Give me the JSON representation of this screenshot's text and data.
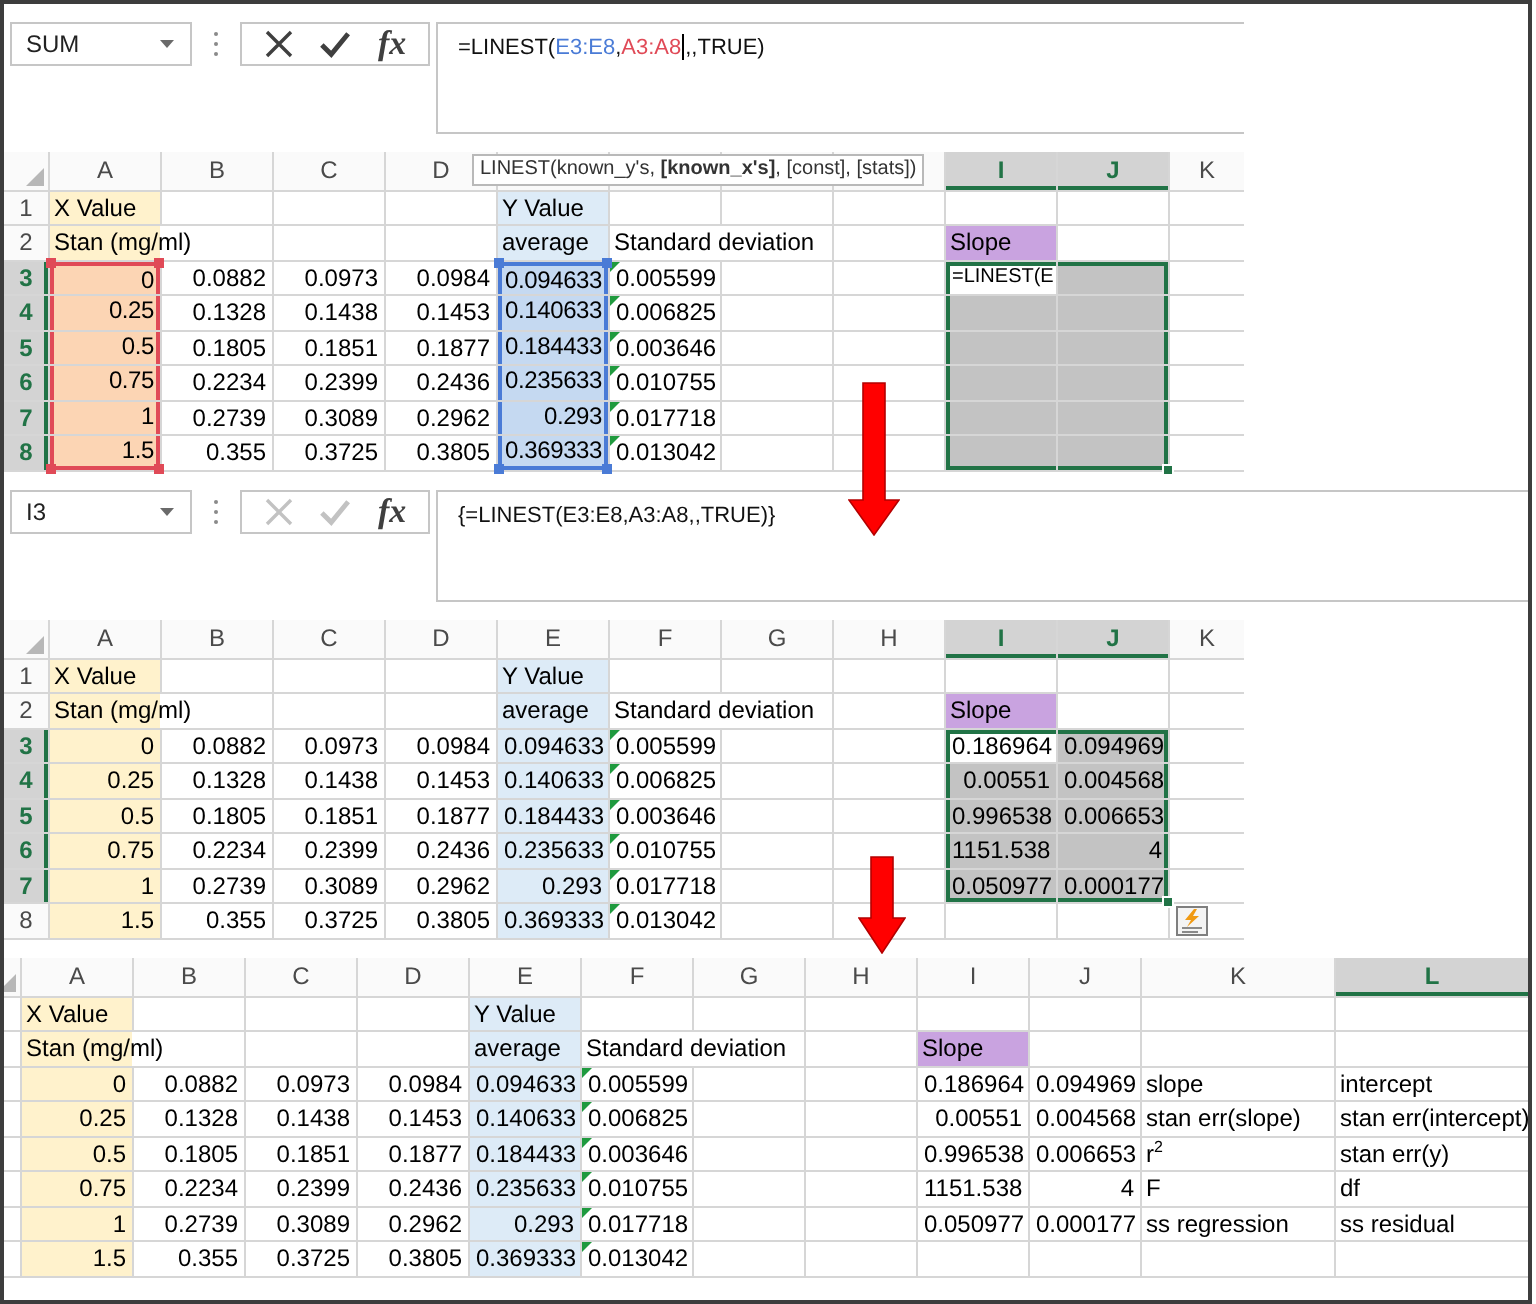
{
  "panels": [
    {
      "formula_bar": {
        "name_box": "SUM",
        "buttons": [
          {
            "kind": "cancel",
            "disabled": false
          },
          {
            "kind": "enter",
            "disabled": false
          },
          {
            "kind": "function",
            "label": "fx",
            "disabled": false
          }
        ],
        "formula": [
          {
            "kind": "plain",
            "text": "=LINEST("
          },
          {
            "kind": "ref",
            "text": "E3:E8",
            "color": "#4a7bd6"
          },
          {
            "kind": "plain",
            "text": ","
          },
          {
            "kind": "ref",
            "text": "A3:A8",
            "color": "#e04a57"
          },
          {
            "kind": "caret"
          },
          {
            "kind": "plain",
            "text": ",,TRUE)"
          }
        ]
      },
      "tooltip": "LINEST(known_y's, **[known_x's]**, [const], [stats])",
      "quick_analysis": false,
      "columns": [
        {
          "label": "A",
          "selected": false
        },
        {
          "label": "B",
          "selected": false
        },
        {
          "label": "C",
          "selected": false
        },
        {
          "label": "D",
          "selected": false
        },
        {},
        {},
        {},
        {},
        {
          "label": "I",
          "selected": true
        },
        {
          "label": "J",
          "selected": true
        },
        {
          "label": "K",
          "selected": false
        }
      ],
      "rows": [
        {
          "number": "1",
          "selected": false,
          "cells": [
            {
              "kind": "text",
              "text": "X Value",
              "color": "#fff2cc"
            },
            null,
            null,
            null,
            {
              "kind": "text",
              "text": "Y Value",
              "color": "#ddebf7"
            }
          ]
        },
        {
          "number": "2",
          "selected": false,
          "cells": [
            {
              "kind": "text",
              "text": "Stan (mg/ml)",
              "color": "#fff2cc"
            },
            null,
            null,
            null,
            {
              "kind": "text",
              "text": "average",
              "color": "#ddebf7"
            },
            {
              "kind": "text",
              "text": "Standard deviation"
            },
            null,
            null,
            {
              "kind": "text",
              "text": "Slope",
              "color": "#c9a3e0"
            }
          ]
        },
        {
          "number": "3",
          "selected": true,
          "cells": [
            {
              "kind": "num",
              "text": "0",
              "color": "#fcd5b4",
              "reference": {
                "color": "#e04a57"
              }
            },
            {
              "kind": "num",
              "text": "0.0882"
            },
            {
              "kind": "num",
              "text": "0.0973"
            },
            {
              "kind": "num",
              "text": "0.0984"
            },
            {
              "kind": "num",
              "text": "0.094633",
              "color": "#c5d9f1",
              "reference": {
                "color": "#4a7bd6"
              }
            },
            {
              "kind": "flag",
              "text": "0.005599"
            },
            null,
            null,
            {
              "kind": "edit",
              "text": "=LINEST(E"
            }
          ]
        },
        {
          "number": "4",
          "selected": true,
          "cells": [
            {
              "kind": "num",
              "text": "0.25",
              "color": "#fcd5b4",
              "reference": {
                "color": "#e04a57"
              }
            },
            {
              "kind": "num",
              "text": "0.1328"
            },
            {
              "kind": "num",
              "text": "0.1438"
            },
            {
              "kind": "num",
              "text": "0.1453"
            },
            {
              "kind": "num",
              "text": "0.140633",
              "color": "#c5d9f1",
              "reference": {
                "color": "#4a7bd6"
              }
            },
            {
              "kind": "flag",
              "text": "0.006825"
            }
          ]
        },
        {
          "number": "5",
          "selected": true,
          "cells": [
            {
              "kind": "num",
              "text": "0.5",
              "color": "#fcd5b4",
              "reference": {
                "color": "#e04a57"
              }
            },
            {
              "kind": "num",
              "text": "0.1805"
            },
            {
              "kind": "num",
              "text": "0.1851"
            },
            {
              "kind": "num",
              "text": "0.1877"
            },
            {
              "kind": "num",
              "text": "0.184433",
              "color": "#c5d9f1",
              "reference": {
                "color": "#4a7bd6"
              }
            },
            {
              "kind": "flag",
              "text": "0.003646"
            }
          ]
        },
        {
          "number": "6",
          "selected": true,
          "cells": [
            {
              "kind": "num",
              "text": "0.75",
              "color": "#fcd5b4",
              "reference": {
                "color": "#e04a57"
              }
            },
            {
              "kind": "num",
              "text": "0.2234"
            },
            {
              "kind": "num",
              "text": "0.2399"
            },
            {
              "kind": "num",
              "text": "0.2436"
            },
            {
              "kind": "num",
              "text": "0.235633",
              "color": "#c5d9f1",
              "reference": {
                "color": "#4a7bd6"
              }
            },
            {
              "kind": "flag",
              "text": "0.010755"
            }
          ]
        },
        {
          "number": "7",
          "selected": true,
          "cells": [
            {
              "kind": "num",
              "text": "1",
              "color": "#fcd5b4",
              "reference": {
                "color": "#e04a57"
              }
            },
            {
              "kind": "num",
              "text": "0.2739"
            },
            {
              "kind": "num",
              "text": "0.3089"
            },
            {
              "kind": "num",
              "text": "0.2962"
            },
            {
              "kind": "num",
              "text": "0.293",
              "color": "#c5d9f1",
              "reference": {
                "color": "#4a7bd6"
              }
            },
            {
              "kind": "flag",
              "text": "0.017718"
            }
          ]
        },
        {
          "number": "8",
          "selected": true,
          "cells": [
            {
              "kind": "num",
              "text": "1.5",
              "color": "#fcd5b4",
              "reference": {
                "color": "#e04a57"
              }
            },
            {
              "kind": "num",
              "text": "0.355"
            },
            {
              "kind": "num",
              "text": "0.3725"
            },
            {
              "kind": "num",
              "text": "0.3805"
            },
            {
              "kind": "num",
              "text": "0.369333",
              "color": "#c5d9f1",
              "reference": {
                "color": "#4a7bd6"
              }
            },
            {
              "kind": "flag",
              "text": "0.013042"
            }
          ]
        }
      ]
    },
    {
      "formula_bar": {
        "name_box": "I3",
        "buttons": [
          {
            "kind": "cancel",
            "disabled": true
          },
          {
            "kind": "enter",
            "disabled": true
          },
          {
            "kind": "function",
            "label": "fx",
            "disabled": false
          }
        ],
        "formula": [
          {
            "kind": "plain",
            "text": "{=LINEST(E3:E8,A3:A8,,TRUE)}"
          }
        ]
      },
      "quick_analysis": true,
      "columns": [
        {
          "label": "A",
          "selected": false
        },
        {
          "label": "B",
          "selected": false
        },
        {
          "label": "C",
          "selected": false
        },
        {
          "label": "D",
          "selected": false
        },
        {
          "label": "E",
          "selected": false
        },
        {
          "label": "F",
          "selected": false
        },
        {
          "label": "G",
          "selected": false
        },
        {
          "label": "H",
          "selected": false
        },
        {
          "label": "I",
          "selected": true
        },
        {
          "label": "J",
          "selected": true
        },
        {
          "label": "K",
          "selected": false
        }
      ],
      "rows": [
        {
          "number": "1",
          "selected": false,
          "cells": [
            {
              "kind": "text",
              "text": "X Value",
              "color": "#fff2cc"
            },
            null,
            null,
            null,
            {
              "kind": "text",
              "text": "Y Value",
              "color": "#ddebf7"
            }
          ]
        },
        {
          "number": "2",
          "selected": false,
          "cells": [
            {
              "kind": "text",
              "text": "Stan (mg/ml)",
              "color": "#fff2cc"
            },
            null,
            null,
            null,
            {
              "kind": "text",
              "text": "average",
              "color": "#ddebf7"
            },
            {
              "kind": "text",
              "text": "Standard deviation"
            },
            null,
            null,
            {
              "kind": "text",
              "text": "Slope",
              "color": "#c9a3e0"
            }
          ]
        },
        {
          "number": "3",
          "selected": true,
          "cells": [
            {
              "kind": "num",
              "text": "0",
              "color": "#fff2cc"
            },
            {
              "kind": "num",
              "text": "0.0882"
            },
            {
              "kind": "num",
              "text": "0.0973"
            },
            {
              "kind": "num",
              "text": "0.0984"
            },
            {
              "kind": "num",
              "text": "0.094633",
              "color": "#ddebf7"
            },
            {
              "kind": "flag",
              "text": "0.005599"
            },
            null,
            null,
            {
              "kind": "num",
              "text": "0.186964"
            },
            {
              "kind": "num",
              "text": "0.094969"
            }
          ]
        },
        {
          "number": "4",
          "selected": true,
          "cells": [
            {
              "kind": "num",
              "text": "0.25",
              "color": "#fff2cc"
            },
            {
              "kind": "num",
              "text": "0.1328"
            },
            {
              "kind": "num",
              "text": "0.1438"
            },
            {
              "kind": "num",
              "text": "0.1453"
            },
            {
              "kind": "num",
              "text": "0.140633",
              "color": "#ddebf7"
            },
            {
              "kind": "flag",
              "text": "0.006825"
            },
            null,
            null,
            {
              "kind": "num",
              "text": "0.00551"
            },
            {
              "kind": "num",
              "text": "0.004568"
            }
          ]
        },
        {
          "number": "5",
          "selected": true,
          "cells": [
            {
              "kind": "num",
              "text": "0.5",
              "color": "#fff2cc"
            },
            {
              "kind": "num",
              "text": "0.1805"
            },
            {
              "kind": "num",
              "text": "0.1851"
            },
            {
              "kind": "num",
              "text": "0.1877"
            },
            {
              "kind": "num",
              "text": "0.184433",
              "color": "#ddebf7"
            },
            {
              "kind": "flag",
              "text": "0.003646"
            },
            null,
            null,
            {
              "kind": "num",
              "text": "0.996538"
            },
            {
              "kind": "num",
              "text": "0.006653"
            }
          ]
        },
        {
          "number": "6",
          "selected": true,
          "cells": [
            {
              "kind": "num",
              "text": "0.75",
              "color": "#fff2cc"
            },
            {
              "kind": "num",
              "text": "0.2234"
            },
            {
              "kind": "num",
              "text": "0.2399"
            },
            {
              "kind": "num",
              "text": "0.2436"
            },
            {
              "kind": "num",
              "text": "0.235633",
              "color": "#ddebf7"
            },
            {
              "kind": "flag",
              "text": "0.010755"
            },
            null,
            null,
            {
              "kind": "num",
              "text": "1151.538"
            },
            {
              "kind": "num",
              "text": "4"
            }
          ]
        },
        {
          "number": "7",
          "selected": true,
          "cells": [
            {
              "kind": "num",
              "text": "1",
              "color": "#fff2cc"
            },
            {
              "kind": "num",
              "text": "0.2739"
            },
            {
              "kind": "num",
              "text": "0.3089"
            },
            {
              "kind": "num",
              "text": "0.2962"
            },
            {
              "kind": "num",
              "text": "0.293",
              "color": "#ddebf7"
            },
            {
              "kind": "flag",
              "text": "0.017718"
            },
            null,
            null,
            {
              "kind": "num",
              "text": "0.050977"
            },
            {
              "kind": "num",
              "text": "0.000177"
            }
          ]
        },
        {
          "number": "8",
          "selected": false,
          "cells": [
            {
              "kind": "num",
              "text": "1.5",
              "color": "#fff2cc"
            },
            {
              "kind": "num",
              "text": "0.355"
            },
            {
              "kind": "num",
              "text": "0.3725"
            },
            {
              "kind": "num",
              "text": "0.3805"
            },
            {
              "kind": "num",
              "text": "0.369333",
              "color": "#ddebf7"
            },
            {
              "kind": "flag",
              "text": "0.013042"
            }
          ]
        }
      ]
    },
    {
      "quick_analysis": false,
      "columns": [
        {
          "label": "A",
          "selected": false
        },
        {
          "label": "B",
          "selected": false
        },
        {
          "label": "C",
          "selected": false
        },
        {
          "label": "D",
          "selected": false
        },
        {
          "label": "E",
          "selected": false
        },
        {
          "label": "F",
          "selected": false
        },
        {
          "label": "G",
          "selected": false
        },
        {
          "label": "H",
          "selected": false
        },
        {
          "label": "I",
          "selected": false
        },
        {
          "label": "J",
          "selected": false
        },
        {
          "label": "K",
          "selected": false
        },
        {
          "label": "L",
          "selected": true
        }
      ],
      "rows": [
        {
          "cells": [
            {
              "kind": "text",
              "text": "X Value",
              "color": "#fff2cc"
            },
            null,
            null,
            null,
            {
              "kind": "text",
              "text": "Y Value",
              "color": "#ddebf7"
            }
          ]
        },
        {
          "cells": [
            {
              "kind": "text",
              "text": "Stan (mg/ml)",
              "color": "#fff2cc"
            },
            null,
            null,
            null,
            {
              "kind": "text",
              "text": "average",
              "color": "#ddebf7"
            },
            {
              "kind": "text",
              "text": "Standard deviation"
            },
            null,
            null,
            {
              "kind": "text",
              "text": "Slope",
              "color": "#c9a3e0"
            }
          ]
        },
        {
          "cells": [
            {
              "kind": "num",
              "text": "0",
              "color": "#fff2cc"
            },
            {
              "kind": "num",
              "text": "0.0882"
            },
            {
              "kind": "num",
              "text": "0.0973"
            },
            {
              "kind": "num",
              "text": "0.0984"
            },
            {
              "kind": "num",
              "text": "0.094633",
              "color": "#ddebf7"
            },
            {
              "kind": "flag",
              "text": "0.005599"
            },
            null,
            null,
            {
              "kind": "num",
              "text": "0.186964"
            },
            {
              "kind": "num",
              "text": "0.094969"
            },
            {
              "kind": "text",
              "text": "slope"
            },
            {
              "kind": "text",
              "text": "intercept"
            }
          ]
        },
        {
          "cells": [
            {
              "kind": "num",
              "text": "0.25",
              "color": "#fff2cc"
            },
            {
              "kind": "num",
              "text": "0.1328"
            },
            {
              "kind": "num",
              "text": "0.1438"
            },
            {
              "kind": "num",
              "text": "0.1453"
            },
            {
              "kind": "num",
              "text": "0.140633",
              "color": "#ddebf7"
            },
            {
              "kind": "flag",
              "text": "0.006825"
            },
            null,
            null,
            {
              "kind": "num",
              "text": "0.00551"
            },
            {
              "kind": "num",
              "text": "0.004568"
            },
            {
              "kind": "text",
              "text": "stan err(slope)"
            },
            {
              "kind": "text",
              "text": "stan err(intercept)"
            }
          ]
        },
        {
          "cells": [
            {
              "kind": "num",
              "text": "0.5",
              "color": "#fff2cc"
            },
            {
              "kind": "num",
              "text": "0.1805"
            },
            {
              "kind": "num",
              "text": "0.1851"
            },
            {
              "kind": "num",
              "text": "0.1877"
            },
            {
              "kind": "num",
              "text": "0.184433",
              "color": "#ddebf7"
            },
            {
              "kind": "flag",
              "text": "0.003646"
            },
            null,
            null,
            {
              "kind": "num",
              "text": "0.996538"
            },
            {
              "kind": "num",
              "text": "0.006653"
            },
            {
              "kind": "text",
              "text": "r$^{2}$"
            },
            {
              "kind": "text",
              "text": "stan err(y)"
            }
          ]
        },
        {
          "cells": [
            {
              "kind": "num",
              "text": "0.75",
              "color": "#fff2cc"
            },
            {
              "kind": "num",
              "text": "0.2234"
            },
            {
              "kind": "num",
              "text": "0.2399"
            },
            {
              "kind": "num",
              "text": "0.2436"
            },
            {
              "kind": "num",
              "text": "0.235633",
              "color": "#ddebf7"
            },
            {
              "kind": "flag",
              "text": "0.010755"
            },
            null,
            null,
            {
              "kind": "num",
              "text": "1151.538"
            },
            {
              "kind": "num",
              "text": "4"
            },
            {
              "kind": "text",
              "text": "F"
            },
            {
              "kind": "text",
              "text": "df"
            }
          ]
        },
        {
          "cells": [
            {
              "kind": "num",
              "text": "1",
              "color": "#fff2cc"
            },
            {
              "kind": "num",
              "text": "0.2739"
            },
            {
              "kind": "num",
              "text": "0.3089"
            },
            {
              "kind": "num",
              "text": "0.2962"
            },
            {
              "kind": "num",
              "text": "0.293",
              "color": "#ddebf7"
            },
            {
              "kind": "flag",
              "text": "0.017718"
            },
            null,
            null,
            {
              "kind": "num",
              "text": "0.050977"
            },
            {
              "kind": "num",
              "text": "0.000177"
            },
            {
              "kind": "text",
              "text": "ss regression"
            },
            {
              "kind": "text",
              "text": "ss residual"
            }
          ]
        },
        {
          "cells": [
            {
              "kind": "num",
              "text": "1.5",
              "color": "#fff2cc"
            },
            {
              "kind": "num",
              "text": "0.355"
            },
            {
              "kind": "num",
              "text": "0.3725"
            },
            {
              "kind": "num",
              "text": "0.3805"
            },
            {
              "kind": "num",
              "text": "0.369333",
              "color": "#ddebf7"
            },
            {
              "kind": "flag",
              "text": "0.013042"
            }
          ]
        }
      ]
    }
  ]
}
